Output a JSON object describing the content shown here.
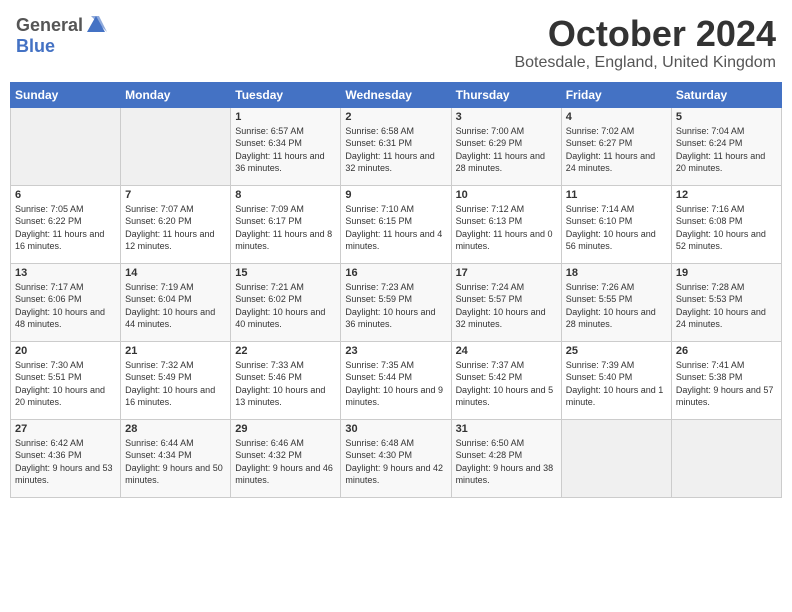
{
  "header": {
    "logo": {
      "general": "General",
      "blue": "Blue"
    },
    "title": "October 2024",
    "location": "Botesdale, England, United Kingdom"
  },
  "weekdays": [
    "Sunday",
    "Monday",
    "Tuesday",
    "Wednesday",
    "Thursday",
    "Friday",
    "Saturday"
  ],
  "weeks": [
    [
      {
        "day": "",
        "sunrise": "",
        "sunset": "",
        "daylight": ""
      },
      {
        "day": "",
        "sunrise": "",
        "sunset": "",
        "daylight": ""
      },
      {
        "day": "1",
        "sunrise": "Sunrise: 6:57 AM",
        "sunset": "Sunset: 6:34 PM",
        "daylight": "Daylight: 11 hours and 36 minutes."
      },
      {
        "day": "2",
        "sunrise": "Sunrise: 6:58 AM",
        "sunset": "Sunset: 6:31 PM",
        "daylight": "Daylight: 11 hours and 32 minutes."
      },
      {
        "day": "3",
        "sunrise": "Sunrise: 7:00 AM",
        "sunset": "Sunset: 6:29 PM",
        "daylight": "Daylight: 11 hours and 28 minutes."
      },
      {
        "day": "4",
        "sunrise": "Sunrise: 7:02 AM",
        "sunset": "Sunset: 6:27 PM",
        "daylight": "Daylight: 11 hours and 24 minutes."
      },
      {
        "day": "5",
        "sunrise": "Sunrise: 7:04 AM",
        "sunset": "Sunset: 6:24 PM",
        "daylight": "Daylight: 11 hours and 20 minutes."
      }
    ],
    [
      {
        "day": "6",
        "sunrise": "Sunrise: 7:05 AM",
        "sunset": "Sunset: 6:22 PM",
        "daylight": "Daylight: 11 hours and 16 minutes."
      },
      {
        "day": "7",
        "sunrise": "Sunrise: 7:07 AM",
        "sunset": "Sunset: 6:20 PM",
        "daylight": "Daylight: 11 hours and 12 minutes."
      },
      {
        "day": "8",
        "sunrise": "Sunrise: 7:09 AM",
        "sunset": "Sunset: 6:17 PM",
        "daylight": "Daylight: 11 hours and 8 minutes."
      },
      {
        "day": "9",
        "sunrise": "Sunrise: 7:10 AM",
        "sunset": "Sunset: 6:15 PM",
        "daylight": "Daylight: 11 hours and 4 minutes."
      },
      {
        "day": "10",
        "sunrise": "Sunrise: 7:12 AM",
        "sunset": "Sunset: 6:13 PM",
        "daylight": "Daylight: 11 hours and 0 minutes."
      },
      {
        "day": "11",
        "sunrise": "Sunrise: 7:14 AM",
        "sunset": "Sunset: 6:10 PM",
        "daylight": "Daylight: 10 hours and 56 minutes."
      },
      {
        "day": "12",
        "sunrise": "Sunrise: 7:16 AM",
        "sunset": "Sunset: 6:08 PM",
        "daylight": "Daylight: 10 hours and 52 minutes."
      }
    ],
    [
      {
        "day": "13",
        "sunrise": "Sunrise: 7:17 AM",
        "sunset": "Sunset: 6:06 PM",
        "daylight": "Daylight: 10 hours and 48 minutes."
      },
      {
        "day": "14",
        "sunrise": "Sunrise: 7:19 AM",
        "sunset": "Sunset: 6:04 PM",
        "daylight": "Daylight: 10 hours and 44 minutes."
      },
      {
        "day": "15",
        "sunrise": "Sunrise: 7:21 AM",
        "sunset": "Sunset: 6:02 PM",
        "daylight": "Daylight: 10 hours and 40 minutes."
      },
      {
        "day": "16",
        "sunrise": "Sunrise: 7:23 AM",
        "sunset": "Sunset: 5:59 PM",
        "daylight": "Daylight: 10 hours and 36 minutes."
      },
      {
        "day": "17",
        "sunrise": "Sunrise: 7:24 AM",
        "sunset": "Sunset: 5:57 PM",
        "daylight": "Daylight: 10 hours and 32 minutes."
      },
      {
        "day": "18",
        "sunrise": "Sunrise: 7:26 AM",
        "sunset": "Sunset: 5:55 PM",
        "daylight": "Daylight: 10 hours and 28 minutes."
      },
      {
        "day": "19",
        "sunrise": "Sunrise: 7:28 AM",
        "sunset": "Sunset: 5:53 PM",
        "daylight": "Daylight: 10 hours and 24 minutes."
      }
    ],
    [
      {
        "day": "20",
        "sunrise": "Sunrise: 7:30 AM",
        "sunset": "Sunset: 5:51 PM",
        "daylight": "Daylight: 10 hours and 20 minutes."
      },
      {
        "day": "21",
        "sunrise": "Sunrise: 7:32 AM",
        "sunset": "Sunset: 5:49 PM",
        "daylight": "Daylight: 10 hours and 16 minutes."
      },
      {
        "day": "22",
        "sunrise": "Sunrise: 7:33 AM",
        "sunset": "Sunset: 5:46 PM",
        "daylight": "Daylight: 10 hours and 13 minutes."
      },
      {
        "day": "23",
        "sunrise": "Sunrise: 7:35 AM",
        "sunset": "Sunset: 5:44 PM",
        "daylight": "Daylight: 10 hours and 9 minutes."
      },
      {
        "day": "24",
        "sunrise": "Sunrise: 7:37 AM",
        "sunset": "Sunset: 5:42 PM",
        "daylight": "Daylight: 10 hours and 5 minutes."
      },
      {
        "day": "25",
        "sunrise": "Sunrise: 7:39 AM",
        "sunset": "Sunset: 5:40 PM",
        "daylight": "Daylight: 10 hours and 1 minute."
      },
      {
        "day": "26",
        "sunrise": "Sunrise: 7:41 AM",
        "sunset": "Sunset: 5:38 PM",
        "daylight": "Daylight: 9 hours and 57 minutes."
      }
    ],
    [
      {
        "day": "27",
        "sunrise": "Sunrise: 6:42 AM",
        "sunset": "Sunset: 4:36 PM",
        "daylight": "Daylight: 9 hours and 53 minutes."
      },
      {
        "day": "28",
        "sunrise": "Sunrise: 6:44 AM",
        "sunset": "Sunset: 4:34 PM",
        "daylight": "Daylight: 9 hours and 50 minutes."
      },
      {
        "day": "29",
        "sunrise": "Sunrise: 6:46 AM",
        "sunset": "Sunset: 4:32 PM",
        "daylight": "Daylight: 9 hours and 46 minutes."
      },
      {
        "day": "30",
        "sunrise": "Sunrise: 6:48 AM",
        "sunset": "Sunset: 4:30 PM",
        "daylight": "Daylight: 9 hours and 42 minutes."
      },
      {
        "day": "31",
        "sunrise": "Sunrise: 6:50 AM",
        "sunset": "Sunset: 4:28 PM",
        "daylight": "Daylight: 9 hours and 38 minutes."
      },
      {
        "day": "",
        "sunrise": "",
        "sunset": "",
        "daylight": ""
      },
      {
        "day": "",
        "sunrise": "",
        "sunset": "",
        "daylight": ""
      }
    ]
  ]
}
